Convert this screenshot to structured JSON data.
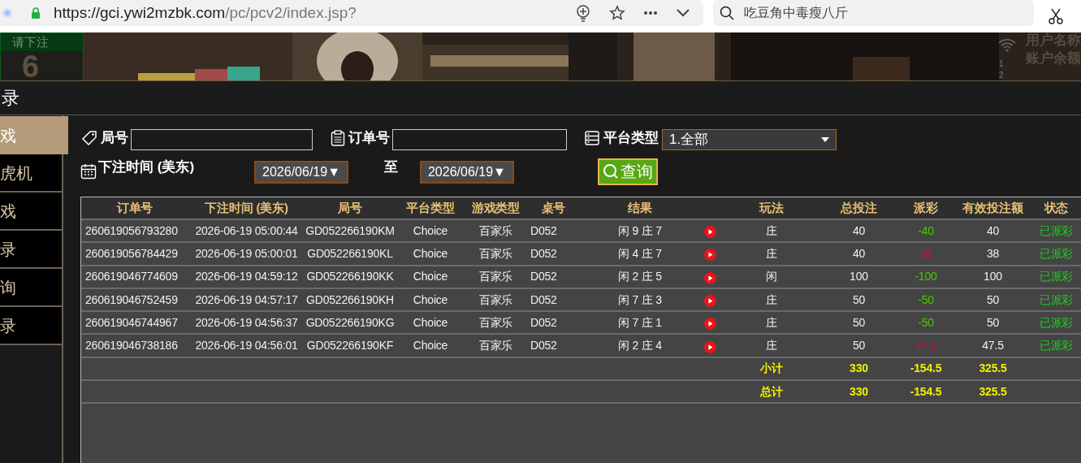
{
  "browser": {
    "url_host": "https://gci.ywi2mzbk.com",
    "url_path": "/pc/pcv2/index.jsp?",
    "search": "吃豆角中毒瘦八斤"
  },
  "banner": {
    "kind": "picture",
    "bet_prompt": "请下注",
    "countdown": "6",
    "info_labels": [
      "用户名称",
      "账户余额"
    ],
    "line_numbers": [
      "1",
      "2"
    ]
  },
  "page_title": "录",
  "sidebar": {
    "items": [
      {
        "label": "戏",
        "selected": true
      },
      {
        "label": "虎机",
        "selected": false
      },
      {
        "label": "戏",
        "selected": false
      },
      {
        "label": "录",
        "selected": false
      },
      {
        "label": "询",
        "selected": false
      },
      {
        "label": "录",
        "selected": false
      }
    ]
  },
  "filters": {
    "round_label": "局号",
    "order_label": "订单号",
    "platform_label": "平台类型",
    "platform_value": "1.全部",
    "time_label": "下注时间 (美东)",
    "date_from": "2026/06/19▼",
    "to_label": "至",
    "date_to": "2026/06/19▼",
    "query_button": "查询"
  },
  "table": {
    "columns": [
      "订单号",
      "下注时间 (美东)",
      "局号",
      "平台类型",
      "游戏类型",
      "桌号",
      "结果",
      "玩法",
      "总投注",
      "派彩",
      "有效投注额",
      "状态"
    ],
    "rows": [
      {
        "order": "260619056793280",
        "time": "2026-06-19 05:00:44",
        "round": "GD052266190KM",
        "platform": "Choice",
        "game": "百家乐",
        "table": "D052",
        "result": "闲 9 庄 7",
        "play": "庄",
        "bet": "40",
        "payout": {
          "text": "-40",
          "color": "#44cc00"
        },
        "valid": "40",
        "status": "已派彩"
      },
      {
        "order": "260619056784429",
        "time": "2026-06-19 05:00:01",
        "round": "GD052266190KL",
        "platform": "Choice",
        "game": "百家乐",
        "table": "D052",
        "result": "闲 4 庄 7",
        "play": "庄",
        "bet": "40",
        "payout": {
          "text": "38",
          "color": "#cc1133"
        },
        "valid": "38",
        "status": "已派彩"
      },
      {
        "order": "260619046774609",
        "time": "2026-06-19 04:59:12",
        "round": "GD052266190KK",
        "platform": "Choice",
        "game": "百家乐",
        "table": "D052",
        "result": "闲 2 庄 5",
        "play": "闲",
        "bet": "100",
        "payout": {
          "text": "-100",
          "color": "#44cc00"
        },
        "valid": "100",
        "status": "已派彩"
      },
      {
        "order": "260619046752459",
        "time": "2026-06-19 04:57:17",
        "round": "GD052266190KH",
        "platform": "Choice",
        "game": "百家乐",
        "table": "D052",
        "result": "闲 7 庄 3",
        "play": "庄",
        "bet": "50",
        "payout": {
          "text": "-50",
          "color": "#44cc00"
        },
        "valid": "50",
        "status": "已派彩"
      },
      {
        "order": "260619046744967",
        "time": "2026-06-19 04:56:37",
        "round": "GD052266190KG",
        "platform": "Choice",
        "game": "百家乐",
        "table": "D052",
        "result": "闲 7 庄 1",
        "play": "庄",
        "bet": "50",
        "payout": {
          "text": "-50",
          "color": "#44cc00"
        },
        "valid": "50",
        "status": "已派彩"
      },
      {
        "order": "260619046738186",
        "time": "2026-06-19 04:56:01",
        "round": "GD052266190KF",
        "platform": "Choice",
        "game": "百家乐",
        "table": "D052",
        "result": "闲 2 庄 4",
        "play": "庄",
        "bet": "50",
        "payout": {
          "text": "47.5",
          "color": "#cc1133"
        },
        "valid": "47.5",
        "status": "已派彩"
      }
    ],
    "totals": [
      {
        "label": "小计",
        "bet": "330",
        "payout": "-154.5",
        "valid": "325.5"
      },
      {
        "label": "总计",
        "bet": "330",
        "payout": "-154.5",
        "valid": "325.5"
      }
    ]
  }
}
